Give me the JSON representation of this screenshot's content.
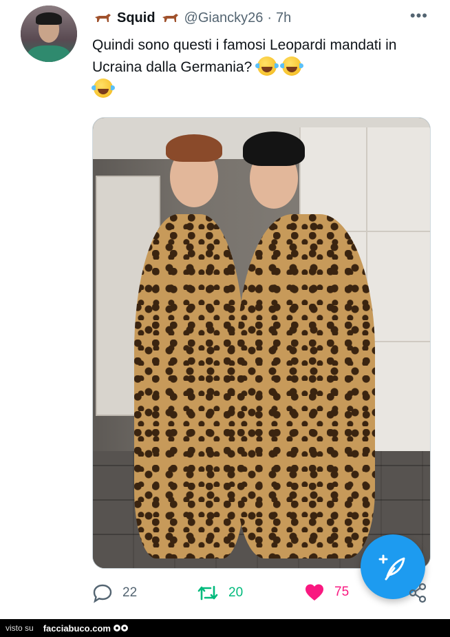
{
  "tweet": {
    "display_name": "Squid",
    "handle": "@Giancky26",
    "separator": "·",
    "time": "7h",
    "more": "•••",
    "text": "Quindi sono questi i famosi Leopardi mandati in Ucraina dalla Germania?",
    "name_emoji": "horse-emoji",
    "text_emoji": "face-with-tears-of-joy-emoji",
    "media_description_icon": "photo",
    "stats": {
      "replies": "22",
      "retweets": "20",
      "likes": "75"
    }
  },
  "colors": {
    "accent": "#1d9bf0",
    "retweet": "#00ba7c",
    "like": "#f91880",
    "muted": "#536471"
  },
  "footer": {
    "visto_label": "visto su",
    "brand": "facciabuco.com"
  }
}
